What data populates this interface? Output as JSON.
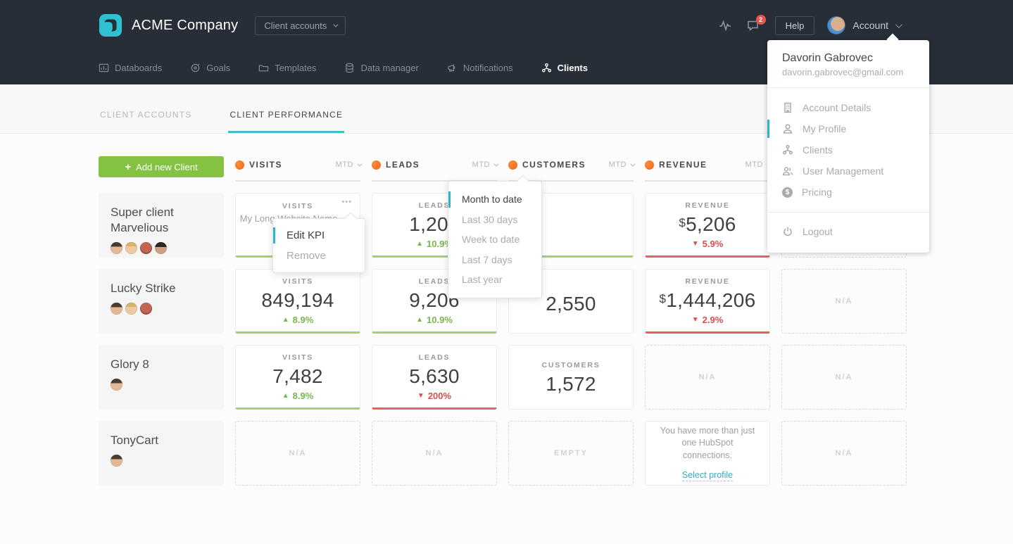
{
  "topbar": {
    "company": "ACME Company",
    "workspace_selector": "Client accounts",
    "help_label": "Help",
    "account_label": "Account",
    "notification_count": "2",
    "nav": [
      {
        "label": "Databoards"
      },
      {
        "label": "Goals"
      },
      {
        "label": "Templates"
      },
      {
        "label": "Data manager"
      },
      {
        "label": "Notifications"
      },
      {
        "label": "Clients",
        "active": true
      }
    ]
  },
  "account_menu": {
    "name": "Davorin Gabrovec",
    "email": "davorin.gabrovec@gmail.com",
    "items": [
      {
        "icon": "building-icon",
        "label": "Account Details"
      },
      {
        "icon": "person-icon",
        "label": "My Profile"
      },
      {
        "icon": "clients-tree-icon",
        "label": "Clients"
      },
      {
        "icon": "users-icon",
        "label": "User Management"
      },
      {
        "icon": "dollar-icon",
        "label": "Pricing"
      }
    ],
    "logout": "Logout"
  },
  "tabs": [
    {
      "label": "CLIENT ACCOUNTS",
      "active": false
    },
    {
      "label": "CLIENT PERFORMANCE",
      "active": true
    }
  ],
  "toolbar": {
    "plus": "+",
    "add_client_label": "Add new Client"
  },
  "columns": [
    {
      "name": "VISITS",
      "period": "MTD"
    },
    {
      "name": "LEADS",
      "period": "MTD"
    },
    {
      "name": "CUSTOMERS",
      "period": "MTD"
    },
    {
      "name": "REVENUE",
      "period": "MTD"
    }
  ],
  "period_menu": {
    "selected": "Month to date",
    "items": [
      "Month to date",
      "Last 30 days",
      "Week to date",
      "Last 7 days",
      "Last year"
    ]
  },
  "kpi_menu": {
    "items": [
      "Edit KPI",
      "Remove"
    ]
  },
  "clients": [
    {
      "name": "Super client Marvelious"
    },
    {
      "name": "Lucky Strike"
    },
    {
      "name": "Glory 8"
    },
    {
      "name": "TonyCart"
    }
  ],
  "cells": {
    "r1c1": {
      "title": "VISITS",
      "subtitle": "My Long Website Name",
      "menu": "•••"
    },
    "r1c2": {
      "title": "LEADS",
      "value": "1,206",
      "delta": "10.9%"
    },
    "r1c4": {
      "title": "REVENUE",
      "currency": "$",
      "value": "5,206",
      "delta": "5.9%"
    },
    "r2c1": {
      "title": "VISITS",
      "value": "849,194",
      "delta": "8.9%"
    },
    "r2c2": {
      "title": "LEADS",
      "value": "9,206",
      "delta": "10.9%"
    },
    "r2c3": {
      "value": "2,550"
    },
    "r2c4": {
      "title": "REVENUE",
      "currency": "$",
      "value": "1,444,206",
      "delta": "2.9%"
    },
    "r3c1": {
      "title": "VISITS",
      "value": "7,482",
      "delta": "8.9%"
    },
    "r3c2": {
      "title": "LEADS",
      "value": "5,630",
      "delta": "200%"
    },
    "r3c3": {
      "title": "CUSTOMERS",
      "value": "1,572"
    },
    "na": "N/A",
    "empty": "EMPTY"
  },
  "hubspot_card": {
    "text": "You have more than just one HubSpot connections.",
    "link": "Select profile"
  },
  "arrows": {
    "up": "▲",
    "down": "▼"
  },
  "colors": {
    "teal": "#3ebdc9",
    "green": "#84c341",
    "green_border": "#a6d06c",
    "red_border": "#e3625e",
    "hubspot_orange": "#f2711c"
  }
}
